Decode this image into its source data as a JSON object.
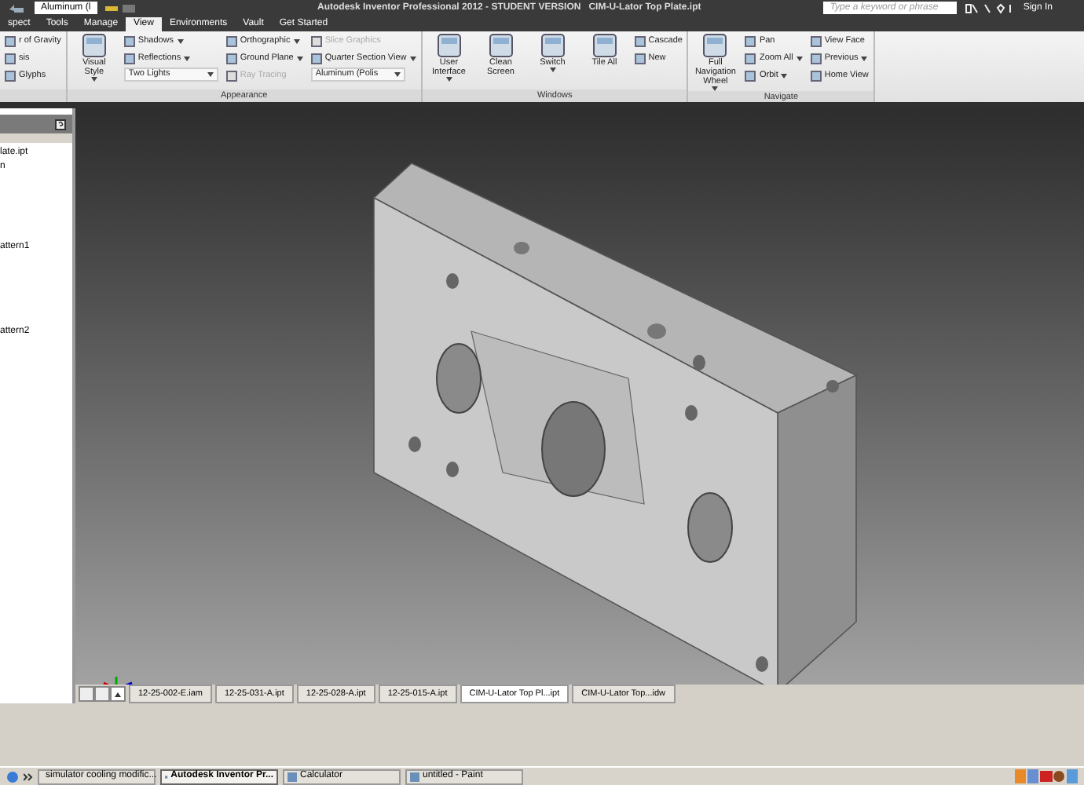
{
  "title_bar": {
    "material": "Aluminum (l",
    "title": "Autodesk Inventor Professional 2012 - STUDENT VERSION   CIM-U-Lator Top Plate.ipt",
    "search_placeholder": "Type a keyword or phrase",
    "sign_in": "Sign In"
  },
  "ribbon_tabs": [
    {
      "label": "spect",
      "selected": false
    },
    {
      "label": "Tools",
      "selected": false
    },
    {
      "label": "Manage",
      "selected": false
    },
    {
      "label": "View",
      "selected": true
    },
    {
      "label": "Environments",
      "selected": false
    },
    {
      "label": "Vault",
      "selected": false
    },
    {
      "label": "Get Started",
      "selected": false
    }
  ],
  "ribbon_panels": [
    {
      "columns": [
        [
          {
            "kind": "small",
            "label": "r of Gravity",
            "disabled": false,
            "dropdown": false
          },
          {
            "kind": "small",
            "label": "sis",
            "disabled": false,
            "dropdown": false
          },
          {
            "kind": "small",
            "label": "Glyphs",
            "disabled": false,
            "dropdown": false
          }
        ]
      ]
    },
    {
      "label": "Appearance",
      "columns": [
        [
          {
            "kind": "large",
            "label": "Visual Style",
            "disabled": false,
            "dropdown": true
          }
        ],
        [
          {
            "kind": "small",
            "label": "Shadows",
            "disabled": false,
            "dropdown": true
          },
          {
            "kind": "small",
            "label": "Reflections",
            "disabled": false,
            "dropdown": true
          },
          {
            "kind": "combo",
            "label": "Two Lights",
            "disabled": false,
            "dropdown": true
          }
        ],
        [
          {
            "kind": "small",
            "label": "Orthographic",
            "disabled": false,
            "dropdown": true
          },
          {
            "kind": "small",
            "label": "Ground Plane",
            "disabled": false,
            "dropdown": true
          },
          {
            "kind": "small",
            "label": "Ray Tracing",
            "disabled": true,
            "dropdown": false
          }
        ],
        [
          {
            "kind": "small",
            "label": "Slice Graphics",
            "disabled": true,
            "dropdown": false
          },
          {
            "kind": "small",
            "label": "Quarter Section View",
            "disabled": false,
            "dropdown": true
          },
          {
            "kind": "combo",
            "label": "Aluminum (Polis",
            "disabled": false,
            "dropdown": true
          }
        ]
      ]
    },
    {
      "label": "Windows",
      "columns": [
        [
          {
            "kind": "large",
            "label": "User Interface",
            "disabled": false,
            "dropdown": true
          }
        ],
        [
          {
            "kind": "large",
            "label": "Clean Screen",
            "disabled": false,
            "dropdown": false
          }
        ],
        [
          {
            "kind": "large",
            "label": "Switch",
            "disabled": false,
            "dropdown": true
          }
        ],
        [
          {
            "kind": "large",
            "label": "Tile All",
            "disabled": false,
            "dropdown": false
          }
        ],
        [
          {
            "kind": "small",
            "label": "Cascade",
            "disabled": false,
            "dropdown": false
          },
          {
            "kind": "small",
            "label": "New",
            "disabled": false,
            "dropdown": false
          }
        ]
      ]
    },
    {
      "label": "Navigate",
      "columns": [
        [
          {
            "kind": "large",
            "label": "Full Navigation Wheel",
            "disabled": false,
            "dropdown": true
          }
        ],
        [
          {
            "kind": "small",
            "label": "Pan",
            "disabled": false,
            "dropdown": false
          },
          {
            "kind": "small",
            "label": "Zoom All",
            "disabled": false,
            "dropdown": true
          },
          {
            "kind": "small",
            "label": "Orbit",
            "disabled": false,
            "dropdown": true
          }
        ],
        [
          {
            "kind": "small",
            "label": "View Face",
            "disabled": false,
            "dropdown": false
          },
          {
            "kind": "small",
            "label": "Previous",
            "disabled": false,
            "dropdown": true
          },
          {
            "kind": "small",
            "label": "Home View",
            "disabled": false,
            "dropdown": false
          }
        ]
      ]
    }
  ],
  "browser_tree": [
    "late.ipt",
    "n",
    "attern1",
    "attern2"
  ],
  "document_tabs": [
    {
      "label": "12-25-002-E.iam",
      "selected": false
    },
    {
      "label": "12-25-031-A.ipt",
      "selected": false
    },
    {
      "label": "12-25-028-A.ipt",
      "selected": false
    },
    {
      "label": "12-25-015-A.ipt",
      "selected": false
    },
    {
      "label": "CIM-U-Lator Top Pl...ipt",
      "selected": true
    },
    {
      "label": "CIM-U-Lator Top...idw",
      "selected": false
    }
  ],
  "taskbar": [
    {
      "label": "simulator cooling modific...",
      "selected": false
    },
    {
      "label": "Autodesk Inventor Pr...",
      "selected": true
    },
    {
      "label": "Calculator",
      "selected": false
    },
    {
      "label": "untitled - Paint",
      "selected": false
    }
  ]
}
